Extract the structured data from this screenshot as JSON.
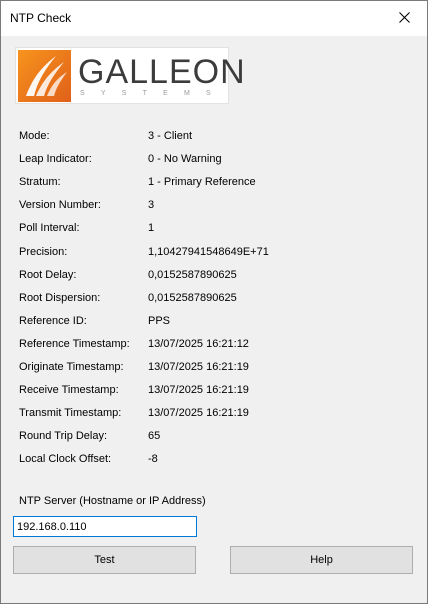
{
  "window": {
    "title": "NTP Check",
    "close_glyph": "close-icon"
  },
  "logo": {
    "word": "GALLEON",
    "sub": "SYSTEMS",
    "accent": "#f47a20"
  },
  "fields": [
    {
      "label": "Mode:",
      "value": "3 - Client"
    },
    {
      "label": "Leap Indicator:",
      "value": "0 - No Warning"
    },
    {
      "label": "Stratum:",
      "value": "1 - Primary Reference"
    },
    {
      "label": "Version Number:",
      "value": "3"
    },
    {
      "label": "Poll Interval:",
      "value": "1"
    },
    {
      "label": "Precision:",
      "value": "1,10427941548649E+71"
    },
    {
      "label": "Root Delay:",
      "value": "0,0152587890625"
    },
    {
      "label": "Root Dispersion:",
      "value": "0,0152587890625"
    },
    {
      "label": "Reference ID:",
      "value": "PPS"
    },
    {
      "label": "Reference Timestamp:",
      "value": "13/07/2025 16:21:12"
    },
    {
      "label": "Originate Timestamp:",
      "value": "13/07/2025 16:21:19"
    },
    {
      "label": "Receive Timestamp:",
      "value": "13/07/2025 16:21:19"
    },
    {
      "label": "Transmit Timestamp:",
      "value": "13/07/2025 16:21:19"
    },
    {
      "label": "Round Trip Delay:",
      "value": "65"
    },
    {
      "label": "Local Clock Offset:",
      "value": "-8"
    }
  ],
  "server": {
    "label": "NTP Server (Hostname or IP Address)",
    "value": "192.168.0.110"
  },
  "buttons": {
    "test": "Test",
    "help": "Help"
  }
}
